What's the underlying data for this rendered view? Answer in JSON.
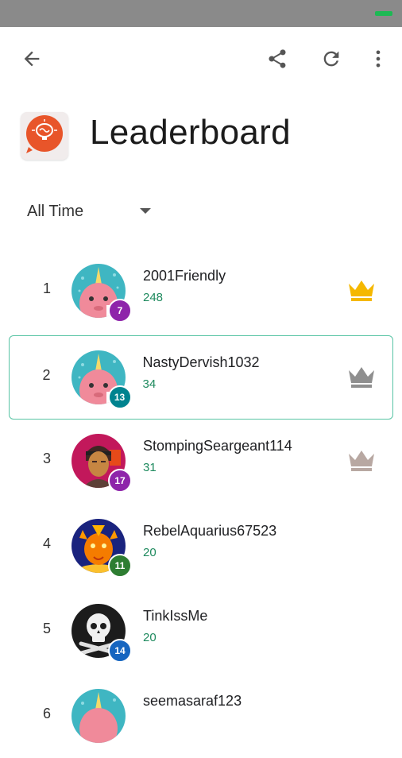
{
  "header": {
    "icons": [
      "arrow-back-icon",
      "share-icon",
      "refresh-icon",
      "more-vert-icon"
    ]
  },
  "title": "Leaderboard",
  "filter": {
    "selected": "All Time"
  },
  "players": [
    {
      "rank": "1",
      "name": "2001Friendly",
      "score": "248",
      "level": "7",
      "badge_color": "#8e24aa",
      "crown": "gold"
    },
    {
      "rank": "2",
      "name": "NastyDervish1032",
      "score": "34",
      "level": "13",
      "badge_color": "#00838f",
      "crown": "silver"
    },
    {
      "rank": "3",
      "name": "StompingSeargeant114",
      "score": "31",
      "level": "17",
      "badge_color": "#8e24aa",
      "crown": "bronze"
    },
    {
      "rank": "4",
      "name": "RebelAquarius67523",
      "score": "20",
      "level": "11",
      "badge_color": "#2e7d32",
      "crown": ""
    },
    {
      "rank": "5",
      "name": "TinkIssMe",
      "score": "20",
      "level": "14",
      "badge_color": "#1565c0",
      "crown": ""
    },
    {
      "rank": "6",
      "name": "seemasaraf123",
      "score": "",
      "level": "",
      "badge_color": "",
      "crown": ""
    }
  ],
  "colors": {
    "score_green": "#1e8a5e",
    "highlight_border": "#58c4a4",
    "crown_gold": "#f5b800",
    "crown_silver": "#8f8f8f",
    "crown_bronze": "#b8a8a2"
  }
}
